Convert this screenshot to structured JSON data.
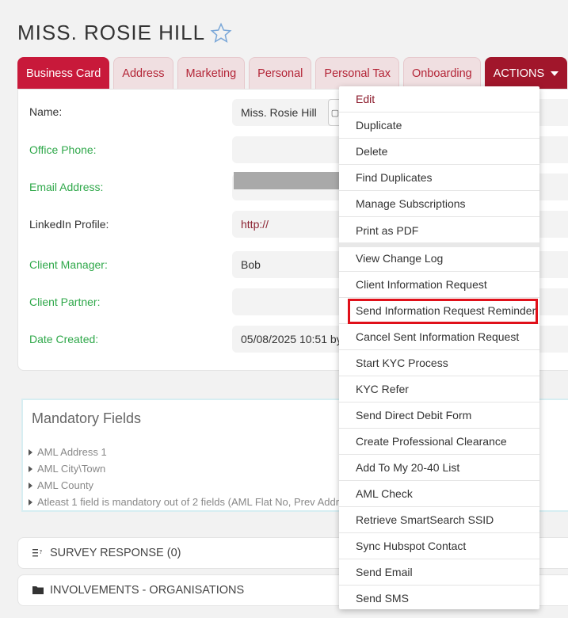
{
  "page": {
    "title": "MISS. ROSIE HILL",
    "favorite_icon": "star-outline-icon"
  },
  "tabs": [
    {
      "label": "Business Card",
      "active": true
    },
    {
      "label": "Address"
    },
    {
      "label": "Marketing"
    },
    {
      "label": "Personal"
    },
    {
      "label": "Personal Tax"
    },
    {
      "label": "Onboarding"
    },
    {
      "label": "ACTIONS"
    }
  ],
  "fields": {
    "name": {
      "label": "Name:",
      "value": "Miss. Rosie Hill"
    },
    "office_phone": {
      "label": "Office Phone:",
      "value": ""
    },
    "email": {
      "label": "Email Address:",
      "value": ""
    },
    "linkedin": {
      "label": "LinkedIn Profile:",
      "value": "http://"
    },
    "client_manager": {
      "label": "Client Manager:",
      "value": "Bob"
    },
    "client_partner": {
      "label": "Client Partner:",
      "value": ""
    },
    "date_created": {
      "label": "Date Created:",
      "value": "05/08/2025 10:51 by"
    }
  },
  "mandatory": {
    "title": "Mandatory Fields",
    "items": [
      "AML Address 1",
      "AML City\\Town",
      "AML County",
      "Atleast 1 field is mandatory out of 2 fields (AML Flat No, Prev Addr"
    ]
  },
  "sections": {
    "survey": "SURVEY RESPONSE (0)",
    "involvements": "INVOLVEMENTS - ORGANISATIONS"
  },
  "actions_menu": [
    "Edit",
    "Duplicate",
    "Delete",
    "Find Duplicates",
    "Manage Subscriptions",
    "Print as PDF",
    "View Change Log",
    "Client Information Request",
    "Send Information Request Reminder",
    "Cancel Sent Information Request",
    "Start KYC Process",
    "KYC Refer",
    "Send Direct Debit Form",
    "Create Professional Clearance",
    "Add To My 20-40 List",
    "AML Check",
    "Retrieve SmartSearch SSID",
    "Sync Hubspot Contact",
    "Send Email",
    "Send SMS"
  ],
  "colors": {
    "accent": "#c8193a",
    "actions": "#a1162b",
    "label_green": "#2fa84a",
    "highlight": "#e0101a"
  }
}
